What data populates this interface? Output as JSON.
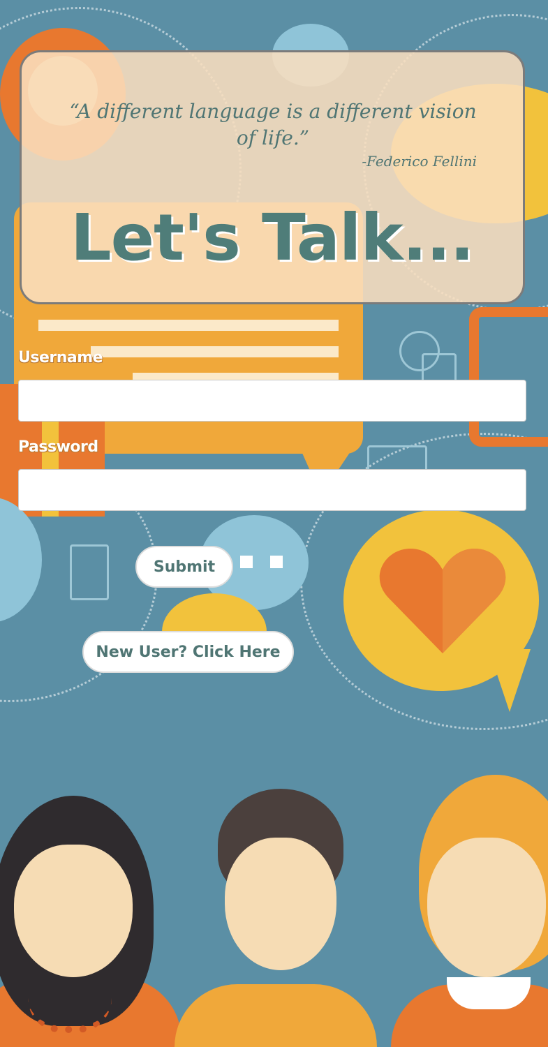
{
  "quote": {
    "text": "“A different language is a different vision of life.”",
    "author": "-Federico Fellini"
  },
  "title": "Let's Talk...",
  "form": {
    "username_label": "Username",
    "username_value": "",
    "password_label": "Password",
    "password_value": "",
    "submit_label": "Submit",
    "new_user_label": "New User? Click Here"
  },
  "colors": {
    "background": "#5b8fa5",
    "card": "#f9debe",
    "accent_teal": "#4f7d79",
    "orange": "#e8782f",
    "yellow": "#f2c23c"
  }
}
